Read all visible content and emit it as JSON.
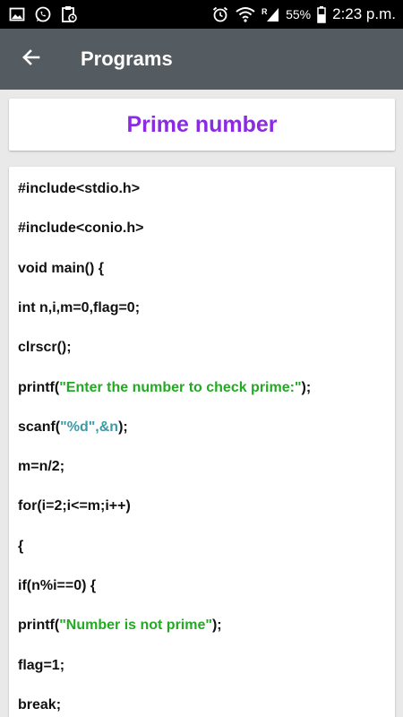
{
  "status_bar": {
    "battery": "55%",
    "time": "2:23 p.m.",
    "network_label": "R",
    "icons": [
      "gallery-icon",
      "whatsapp-icon",
      "clipboard-icon",
      "alarm-icon",
      "wifi-icon",
      "signal-icon",
      "battery-icon"
    ]
  },
  "app_bar": {
    "title": "Programs",
    "back_icon": "arrow-left-icon"
  },
  "program": {
    "title": "Prime number",
    "title_color": "#8a2be2",
    "code_lines": [
      {
        "pre": "#include<stdio.h>",
        "str": "",
        "str_type": "",
        "post": ""
      },
      {
        "pre": "#include<conio.h>",
        "str": "",
        "str_type": "",
        "post": ""
      },
      {
        "pre": "void main() {",
        "str": "",
        "str_type": "",
        "post": ""
      },
      {
        "pre": "int n,i,m=0,flag=0;",
        "str": "",
        "str_type": "",
        "post": ""
      },
      {
        "pre": "clrscr();",
        "str": "",
        "str_type": "",
        "post": ""
      },
      {
        "pre": "printf(",
        "str": "\"Enter the number to check prime:\"",
        "str_type": "green",
        "post": ");"
      },
      {
        "pre": "scanf(",
        "str": "\"%d\",&n",
        "str_type": "teal",
        "post": ");"
      },
      {
        "pre": "m=n/2;",
        "str": "",
        "str_type": "",
        "post": ""
      },
      {
        "pre": "for(i=2;i<=m;i++)",
        "str": "",
        "str_type": "",
        "post": ""
      },
      {
        "pre": "{",
        "str": "",
        "str_type": "",
        "post": ""
      },
      {
        "pre": "if(n%i==0) {",
        "str": "",
        "str_type": "",
        "post": ""
      },
      {
        "pre": "printf(",
        "str": "\"Number is not prime\"",
        "str_type": "green",
        "post": ");"
      },
      {
        "pre": "flag=1;",
        "str": "",
        "str_type": "",
        "post": ""
      },
      {
        "pre": "break;",
        "str": "",
        "str_type": "",
        "post": ""
      }
    ]
  },
  "colors": {
    "app_bar": "#545b61",
    "string_green": "#22aa22",
    "string_teal": "#3b9ba8"
  }
}
